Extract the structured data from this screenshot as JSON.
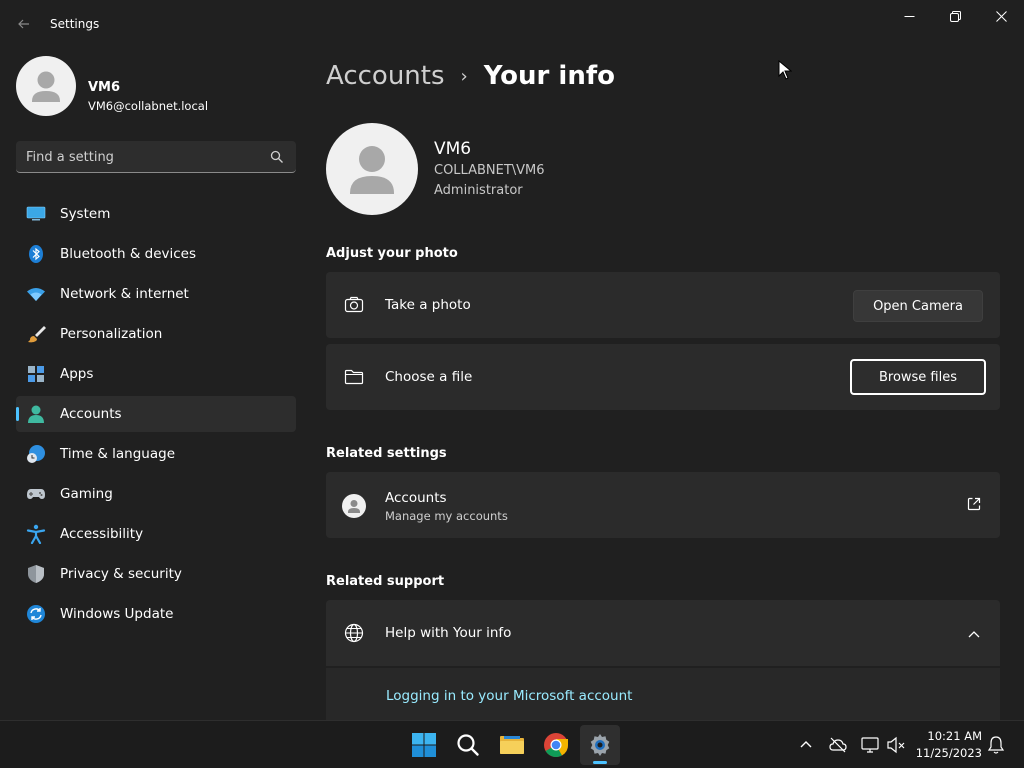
{
  "window": {
    "title": "Settings"
  },
  "profile": {
    "name": "VM6",
    "email": "VM6@collabnet.local"
  },
  "search": {
    "placeholder": "Find a setting"
  },
  "nav": {
    "items": [
      {
        "label": "System",
        "icon": "system-icon"
      },
      {
        "label": "Bluetooth & devices",
        "icon": "bluetooth-icon"
      },
      {
        "label": "Network & internet",
        "icon": "wifi-icon"
      },
      {
        "label": "Personalization",
        "icon": "brush-icon"
      },
      {
        "label": "Apps",
        "icon": "apps-icon"
      },
      {
        "label": "Accounts",
        "icon": "accounts-icon",
        "active": true
      },
      {
        "label": "Time & language",
        "icon": "globe-clock-icon"
      },
      {
        "label": "Gaming",
        "icon": "gamepad-icon"
      },
      {
        "label": "Accessibility",
        "icon": "accessibility-icon"
      },
      {
        "label": "Privacy & security",
        "icon": "shield-icon"
      },
      {
        "label": "Windows Update",
        "icon": "update-icon"
      }
    ]
  },
  "breadcrumb": {
    "parent": "Accounts",
    "separator": "›",
    "current": "Your info"
  },
  "user": {
    "name": "VM6",
    "domain": "COLLABNET\\VM6",
    "role": "Administrator"
  },
  "adjust_photo": {
    "title": "Adjust your photo",
    "take_photo": {
      "label": "Take a photo",
      "button": "Open Camera"
    },
    "choose_file": {
      "label": "Choose a file",
      "button": "Browse files"
    }
  },
  "related_settings": {
    "title": "Related settings",
    "accounts": {
      "label": "Accounts",
      "sub": "Manage my accounts"
    }
  },
  "related_support": {
    "title": "Related support",
    "help": {
      "label": "Help with Your info"
    },
    "links": [
      "Logging in to your Microsoft account"
    ]
  },
  "taskbar": {
    "time": "10:21 AM",
    "date": "11/25/2023"
  },
  "colors": {
    "accent": "#4cc2ff",
    "background": "#202020",
    "card": "#2b2b2b",
    "link": "#99ebff"
  }
}
